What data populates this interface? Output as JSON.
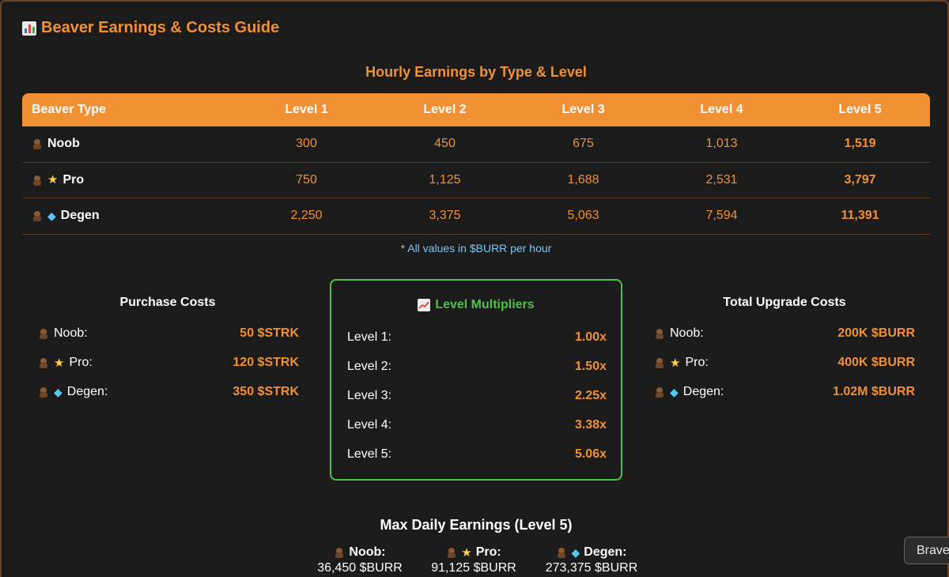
{
  "title": "Beaver Earnings & Costs Guide",
  "table": {
    "heading": "Hourly Earnings by Type & Level",
    "columns": [
      "Beaver Type",
      "Level 1",
      "Level 2",
      "Level 3",
      "Level 4",
      "Level 5"
    ],
    "rows": [
      {
        "name": "Noob",
        "badge": "",
        "values": [
          "300",
          "450",
          "675",
          "1,013",
          "1,519"
        ]
      },
      {
        "name": "Pro",
        "badge": "star-icon",
        "values": [
          "750",
          "1,125",
          "1,688",
          "2,531",
          "3,797"
        ]
      },
      {
        "name": "Degen",
        "badge": "gem-icon",
        "values": [
          "2,250",
          "3,375",
          "5,063",
          "7,594",
          "11,391"
        ]
      }
    ],
    "note": "* All values in $BURR per hour"
  },
  "purchase": {
    "title": "Purchase Costs",
    "items": [
      {
        "label": "Noob:",
        "value": "50 $STRK"
      },
      {
        "label": "Pro:",
        "value": "120 $STRK"
      },
      {
        "label": "Degen:",
        "value": "350 $STRK"
      }
    ]
  },
  "multipliers": {
    "title": "Level Multipliers",
    "items": [
      {
        "label": "Level 1:",
        "value": "1.00x"
      },
      {
        "label": "Level 2:",
        "value": "1.50x"
      },
      {
        "label": "Level 3:",
        "value": "2.25x"
      },
      {
        "label": "Level 4:",
        "value": "3.38x"
      },
      {
        "label": "Level 5:",
        "value": "5.06x"
      }
    ]
  },
  "upgrade": {
    "title": "Total Upgrade Costs",
    "items": [
      {
        "label": "Noob:",
        "value": "200K $BURR"
      },
      {
        "label": "Pro:",
        "value": "400K $BURR"
      },
      {
        "label": "Degen:",
        "value": "1.02M $BURR"
      }
    ]
  },
  "daily": {
    "title": "Max Daily Earnings (Level 5)",
    "items": [
      {
        "label": "Noob:",
        "value": "36,450 $BURR"
      },
      {
        "label": "Pro:",
        "value": "91,125 $BURR"
      },
      {
        "label": "Degen:",
        "value": "273,375 $BURR"
      }
    ]
  },
  "browser": {
    "button_label": "Brave"
  },
  "colors": {
    "accent": "#f29133",
    "green": "#4fc14a",
    "note": "#7fc8f0",
    "background": "#1b1b1b"
  }
}
